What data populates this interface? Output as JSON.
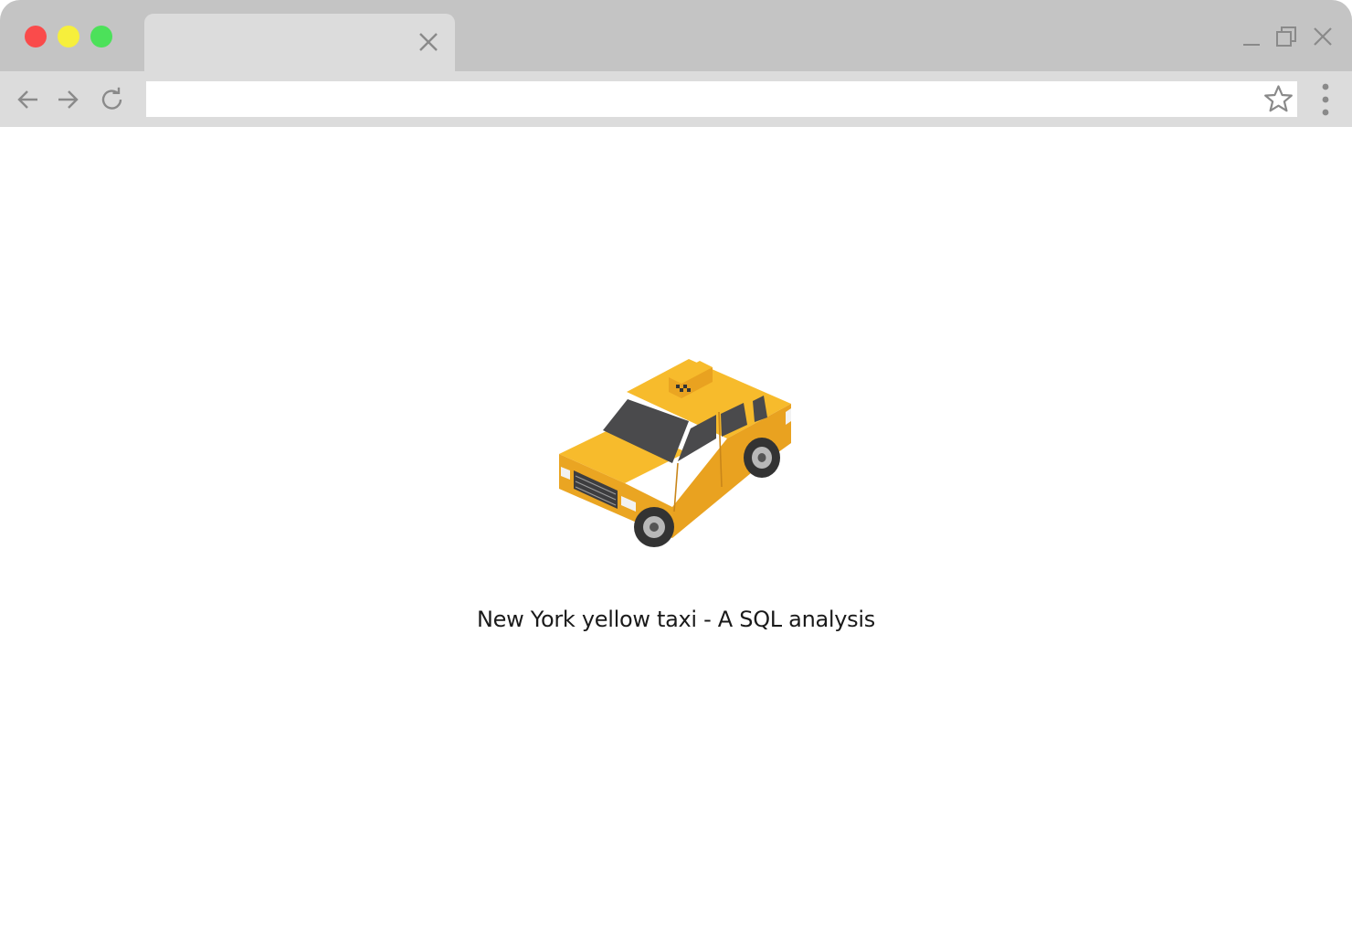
{
  "browser": {
    "tab": {
      "title": ""
    },
    "address_bar": {
      "value": "",
      "placeholder": ""
    }
  },
  "page": {
    "caption": "New York yellow taxi - A SQL analysis",
    "illustration": "isometric-yellow-taxi"
  },
  "colors": {
    "titlebar": "#c4c4c4",
    "toolbar": "#dcdcdc",
    "traffic_red": "#fa4b4b",
    "traffic_yellow": "#f6ef3c",
    "traffic_green": "#4ce15a",
    "taxi_yellow": "#f5b72a",
    "icon_gray": "#8a8a8a"
  },
  "icons": {
    "back": "arrow-left-icon",
    "forward": "arrow-right-icon",
    "reload": "reload-icon",
    "bookmark": "star-icon",
    "menu": "vertical-dots-icon",
    "tab_close": "close-icon",
    "minimize": "minimize-icon",
    "maximize": "restore-icon",
    "window_close": "close-icon"
  }
}
